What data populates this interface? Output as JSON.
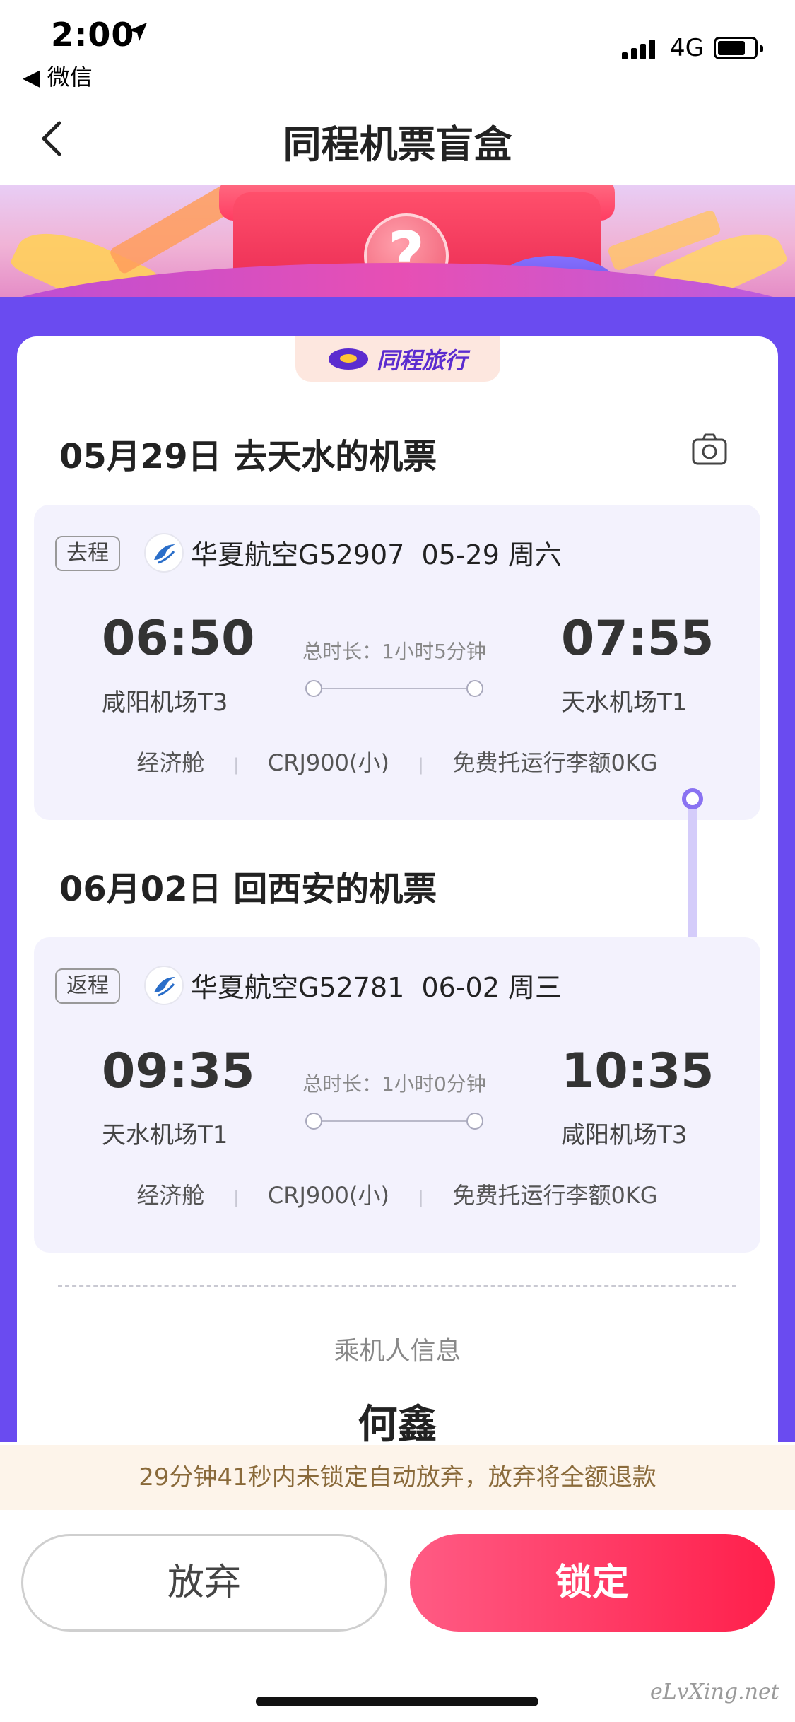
{
  "status_bar": {
    "time": "2:00",
    "back_app": "◀ 微信",
    "network": "4G"
  },
  "nav": {
    "title": "同程机票盲盒"
  },
  "brand": {
    "name": "同程旅行"
  },
  "outbound": {
    "section_title": "05月29日 去天水的机票",
    "tag": "去程",
    "flight_info": "华夏航空G52907  05-29 周六",
    "dep_time": "06:50",
    "dep_airport": "咸阳机场T3",
    "duration": "总时长：1小时5分钟",
    "arr_time": "07:55",
    "arr_airport": "天水机场T1",
    "cabin": "经济舱",
    "aircraft": "CRJ900(小)",
    "baggage": "免费托运行李额0KG"
  },
  "return": {
    "section_title": "06月02日 回西安的机票",
    "tag": "返程",
    "flight_info": "华夏航空G52781  06-02 周三",
    "dep_time": "09:35",
    "dep_airport": "天水机场T1",
    "duration": "总时长：1小时0分钟",
    "arr_time": "10:35",
    "arr_airport": "咸阳机场T3",
    "cabin": "经济舱",
    "aircraft": "CRJ900(小)",
    "baggage": "免费托运行李额0KG"
  },
  "passenger": {
    "title": "乘机人信息",
    "name": "何鑫"
  },
  "notice": "29分钟41秒内未锁定自动放弃，放弃将全额退款",
  "buttons": {
    "abandon": "放弃",
    "lock": "锁定"
  },
  "watermark": "eLvXing.net",
  "colors": {
    "accent_purple": "#6a4bf0",
    "lock_red": "#ff1f4b",
    "panel_bg": "#f3f2fd"
  }
}
